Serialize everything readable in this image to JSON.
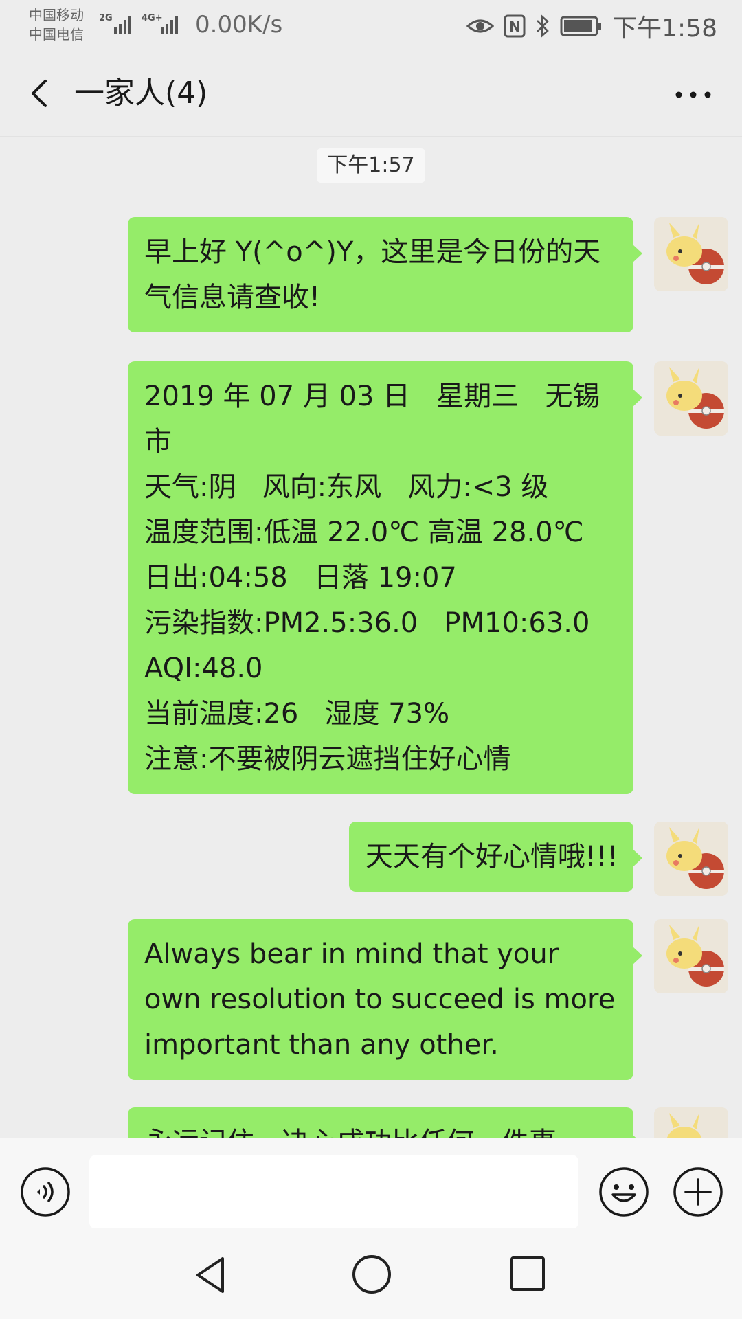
{
  "status_bar": {
    "carrier_1": "中国移动",
    "carrier_2": "中国电信",
    "sig1_label": "2G",
    "sig2_label": "4G+",
    "net_speed": "0.00K/s",
    "nfc_label": "N",
    "time": "下午1:58",
    "icons": [
      "eye-icon",
      "nfc-icon",
      "bluetooth-icon",
      "battery-icon"
    ]
  },
  "header": {
    "title": "一家人(4)",
    "back_icon": "back-arrow-icon",
    "more_icon": "more-icon"
  },
  "chat": {
    "timestamp": "下午1:57",
    "messages": [
      {
        "sender": "self",
        "text": "早上好 Y(^o^)Y，这里是今日份的天气信息请查收!"
      },
      {
        "sender": "self",
        "text": "2019 年 07 月 03 日   星期三   无锡市\n天气:阴   风向:东风   风力:<3 级\n温度范围:低温 22.0℃ 高温 28.0℃\n日出:04:58   日落 19:07\n污染指数:PM2.5:36.0   PM10:63.0\nAQI:48.0\n当前温度:26   湿度 73%\n注意:不要被阴云遮挡住好心情"
      },
      {
        "sender": "self",
        "text": "天天有个好心情哦!!!"
      },
      {
        "sender": "self",
        "text": "Always bear in mind that your own resolution to succeed is more important than any other."
      },
      {
        "sender": "self",
        "text": "永远记住，决心成功比任何一件事"
      }
    ]
  },
  "input_bar": {
    "voice_icon": "voice-icon",
    "text_value": "",
    "emoji_icon": "emoji-icon",
    "plus_icon": "plus-icon"
  },
  "nav_bar": {
    "icons": [
      "nav-back-icon",
      "nav-home-icon",
      "nav-recent-icon"
    ]
  },
  "colors": {
    "background": "#ededed",
    "bubble": "#95ec69",
    "timestamp_bg": "#f7f7f7",
    "input_bar_bg": "#f7f7f7"
  }
}
